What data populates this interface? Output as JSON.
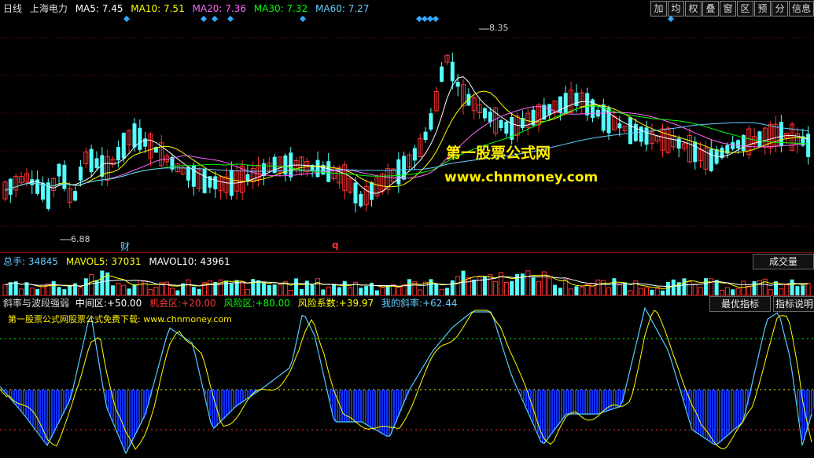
{
  "main": {
    "period": "日线",
    "stock": "上海电力",
    "ma": [
      {
        "label": "MA5: 7.45",
        "color": "#ffffff"
      },
      {
        "label": "MA10: 7.51",
        "color": "#ffff00"
      },
      {
        "label": "MA20: 7.36",
        "color": "#ff66ff"
      },
      {
        "label": "MA30: 7.32",
        "color": "#00ff00"
      },
      {
        "label": "MA60: 7.27",
        "color": "#66ccff"
      }
    ],
    "high_price": "8.35",
    "low_price": "6.88",
    "marker_fin": "财",
    "marker_q": "q"
  },
  "toolbar": [
    "加",
    "均",
    "权",
    "叠",
    "窗",
    "区",
    "预",
    "分",
    "信息"
  ],
  "watermark": {
    "line1": "第一股票公式网",
    "line2": "www.chnmoney.com"
  },
  "volume": {
    "items": [
      {
        "label": "总手:",
        "value": "34845",
        "color": "#66ccff"
      },
      {
        "label": "MAVOL5:",
        "value": "37031",
        "color": "#ffff00"
      },
      {
        "label": "MAVOL10:",
        "value": "43961",
        "color": "#ffffff"
      }
    ],
    "button": "成交量"
  },
  "indicator": {
    "name": "斜率与波段强弱",
    "items": [
      {
        "label": "中间区:",
        "value": "+50.00",
        "color": "#ffffff"
      },
      {
        "label": "机会区:",
        "value": "+20.00",
        "color": "#ff3333"
      },
      {
        "label": "风险区:",
        "value": "+80.00",
        "color": "#00ff00"
      },
      {
        "label": "风险系数:",
        "value": "+39.97",
        "color": "#ffff00"
      },
      {
        "label": "我的斜率:",
        "value": "+62.44",
        "color": "#66ccff"
      }
    ],
    "subtitle": "第一股票公式网股票公式免费下载: www.chnmoney.com",
    "buttons": [
      "最优指标",
      "指标说明"
    ]
  },
  "colors": {
    "up": "#ff3333",
    "down": "#55ffff",
    "grid": "#7a1010"
  }
}
